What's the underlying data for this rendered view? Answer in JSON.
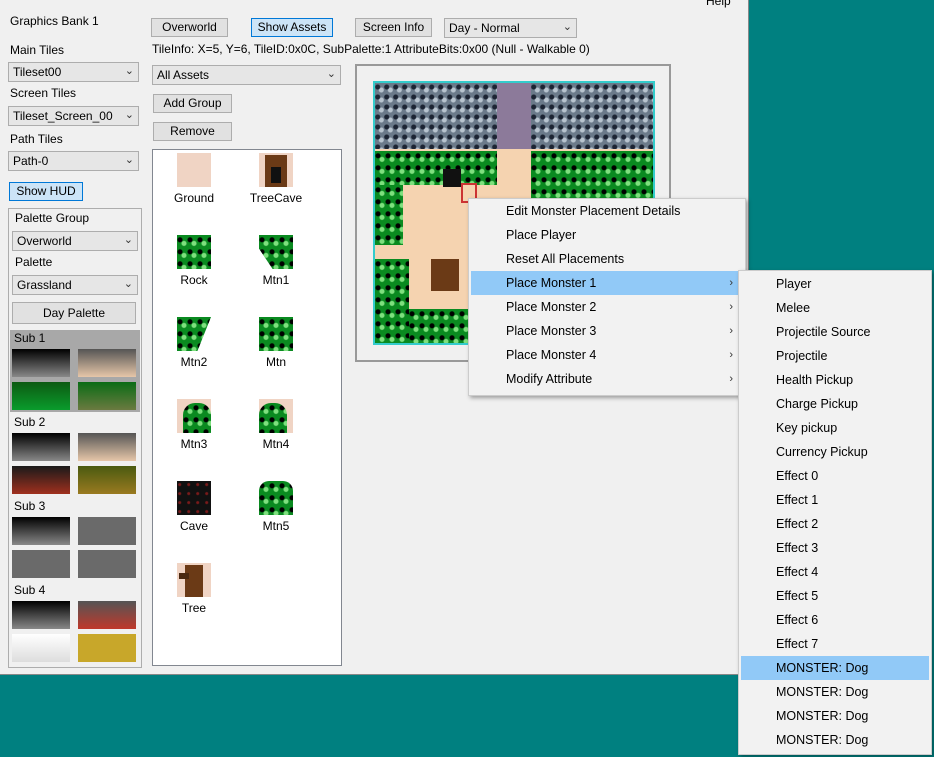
{
  "menu": {
    "help": "Help"
  },
  "left": {
    "graphics_bank": "Graphics Bank 1",
    "main_tiles_label": "Main Tiles",
    "main_tiles_value": "Tileset00",
    "screen_tiles_label": "Screen Tiles",
    "screen_tiles_value": "Tileset_Screen_00",
    "path_tiles_label": "Path Tiles",
    "path_tiles_value": "Path-0",
    "show_hud": "Show HUD",
    "palette_group_label": "Palette Group",
    "palette_group_value": "Overworld",
    "palette_label": "Palette",
    "palette_value": "Grassland",
    "day_palette": "Day Palette",
    "subs": [
      "Sub 1",
      "Sub 2",
      "Sub 3",
      "Sub 4"
    ]
  },
  "toolbar": {
    "overworld": "Overworld",
    "show_assets": "Show Assets",
    "screen_info": "Screen Info",
    "time_value": "Day - Normal",
    "tileinfo": "TileInfo: X=5, Y=6, TileID:0x0C, SubPalette:1 AttributeBits:0x00 (Null - Walkable 0)"
  },
  "assets": {
    "filter_value": "All Assets",
    "add_group": "Add Group",
    "remove": "Remove",
    "items": [
      "Ground",
      "TreeCave",
      "Rock",
      "Mtn1",
      "Mtn2",
      "Mtn",
      "Mtn3",
      "Mtn4",
      "Cave",
      "Mtn5",
      "Tree"
    ]
  },
  "context_menu": {
    "items": [
      "Edit Monster Placement Details",
      "Place Player",
      "Reset All Placements",
      "Place Monster 1",
      "Place Monster 2",
      "Place Monster 3",
      "Place Monster 4",
      "Modify Attribute"
    ]
  },
  "submenu": {
    "items": [
      "Player",
      "Melee",
      "Projectile Source",
      "Projectile",
      "Health Pickup",
      "Charge Pickup",
      "Key pickup",
      "Currency Pickup",
      "Effect 0",
      "Effect 1",
      "Effect 2",
      "Effect 3",
      "Effect 4",
      "Effect 5",
      "Effect 6",
      "Effect 7",
      "MONSTER: Dog",
      "MONSTER: Dog",
      "MONSTER: Dog",
      "MONSTER: Dog"
    ]
  },
  "colors": {
    "desktop": "#008080",
    "highlight": "#91c9f7",
    "selected_button": "#cce4f7"
  }
}
